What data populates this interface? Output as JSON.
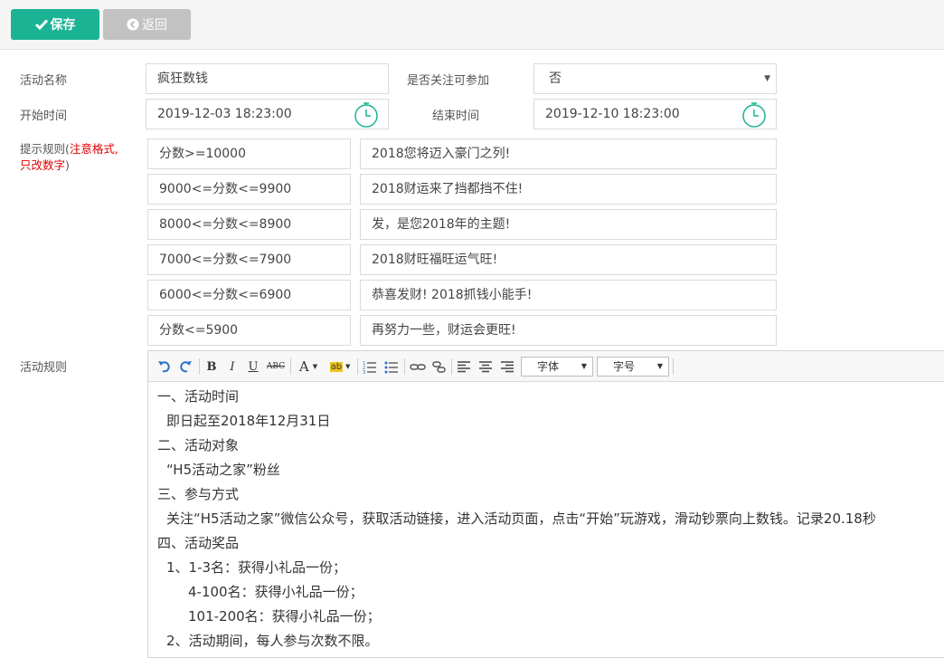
{
  "toolbar": {
    "save_label": "保存",
    "back_label": "返回"
  },
  "form": {
    "name_label": "活动名称",
    "name_value": "疯狂数钱",
    "follow_label": "是否关注可参加",
    "follow_value": "否",
    "start_label": "开始时间",
    "start_value": "2019-12-03 18:23:00",
    "end_label": "结束时间",
    "end_value": "2019-12-10 18:23:00",
    "tips_label_prefix": "提示规则(",
    "tips_label_note1": "注意格式,",
    "tips_label_note2": "只改数字",
    "tips_label_suffix": ")",
    "rules_label": "活动规则"
  },
  "tips": [
    {
      "range": "分数>=10000",
      "message": "2018您将迈入豪门之列!"
    },
    {
      "range": "9000<=分数<=9900",
      "message": "2018财运来了挡都挡不住!"
    },
    {
      "range": "8000<=分数<=8900",
      "message": "发，是您2018年的主题!"
    },
    {
      "range": "7000<=分数<=7900",
      "message": "2018财旺福旺运气旺!"
    },
    {
      "range": "6000<=分数<=6900",
      "message": "恭喜发财! 2018抓钱小能手!"
    },
    {
      "range": "分数<=5900",
      "message": "再努力一些，财运会更旺!"
    }
  ],
  "editor": {
    "font_label": "字体",
    "size_label": "字号",
    "lines": [
      "一、活动时间",
      "即日起至2018年12月31日",
      "二、活动对象",
      "“H5活动之家”粉丝",
      "三、参与方式",
      "关注“H5活动之家”微信公众号，获取活动链接，进入活动页面，点击“开始”玩游戏，滑动钞票向上数钱。记录20.18秒",
      "四、活动奖品",
      "1、1-3名：获得小礼品一份；",
      "4-100名：获得小礼品一份；",
      "101-200名：获得小礼品一份；",
      "2、活动期间，每人参与次数不限。"
    ]
  },
  "colors": {
    "primary": "#1ab394",
    "back": "#c2c2c2",
    "note": "#e00000",
    "icon": "#1ab394"
  }
}
